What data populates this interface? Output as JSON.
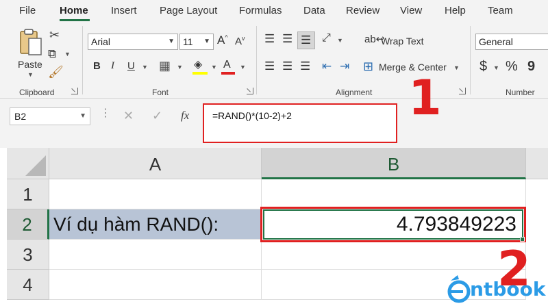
{
  "menu": {
    "tabs": [
      "File",
      "Home",
      "Insert",
      "Page Layout",
      "Formulas",
      "Data",
      "Review",
      "View",
      "Help",
      "Team"
    ],
    "active": "Home"
  },
  "ribbon": {
    "clipboard": {
      "paste_label": "Paste",
      "group_label": "Clipboard"
    },
    "font": {
      "font_name": "Arial",
      "font_size": "11",
      "group_label": "Font",
      "bold": "B",
      "italic": "I",
      "underline": "U"
    },
    "alignment": {
      "wrap_text": "Wrap Text",
      "merge_center": "Merge & Center",
      "group_label": "Alignment"
    },
    "number": {
      "format": "General",
      "group_label": "Number",
      "currency": "$",
      "percent": "%",
      "comma": "9"
    }
  },
  "formula_bar": {
    "name_box": "B2",
    "fx_label": "fx",
    "formula": "=RAND()*(10-2)+2"
  },
  "grid": {
    "columns": [
      "A",
      "B"
    ],
    "rows": [
      "1",
      "2",
      "3",
      "4"
    ],
    "cells": {
      "A2": "Ví dụ hàm RAND():",
      "B2": "4.793849223"
    }
  },
  "annotations": [
    "1",
    "2"
  ],
  "logo": {
    "text": "ntbook"
  },
  "colors": {
    "accent": "#217346",
    "annotation": "#e02020",
    "highlight": "#b8c4d6",
    "logo": "#2b9be6"
  }
}
